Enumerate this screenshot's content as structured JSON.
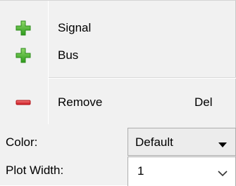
{
  "menu": {
    "items": [
      {
        "label": "Signal",
        "icon": "plus-icon"
      },
      {
        "label": "Bus",
        "icon": "plus-icon"
      },
      {
        "label": "Remove",
        "icon": "minus-icon",
        "shortcut": "Del"
      }
    ]
  },
  "color": {
    "label": "Color:",
    "value": "Default"
  },
  "plot_width": {
    "label": "Plot Width:",
    "value": "1"
  },
  "colors": {
    "add_icon": "#3fae2a",
    "remove_icon": "#d81f26",
    "background": "#f1f1f1"
  }
}
